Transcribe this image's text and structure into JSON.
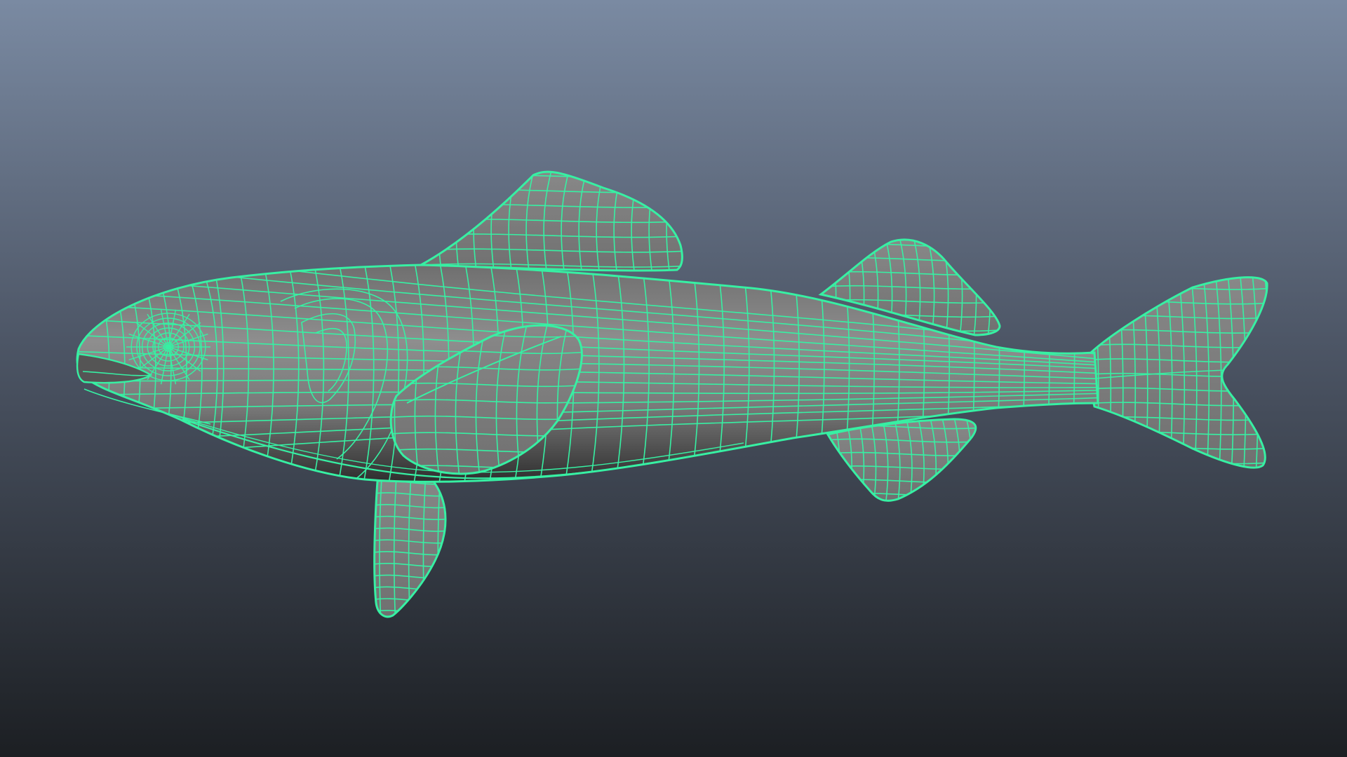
{
  "viewport": {
    "background_top_color": "#7a8aa2",
    "background_bottom_color": "#1c1f23",
    "shading": "smooth-shade-with-wireframe",
    "object": "fish-model"
  },
  "colors": {
    "wireframe": "#37f0a3",
    "wireframe_outline": "#2bd98d",
    "surface_light": "#959595",
    "surface_mid": "#7c7c7c",
    "surface_dark": "#3c3c3c",
    "fin": "#7e7e7e"
  }
}
